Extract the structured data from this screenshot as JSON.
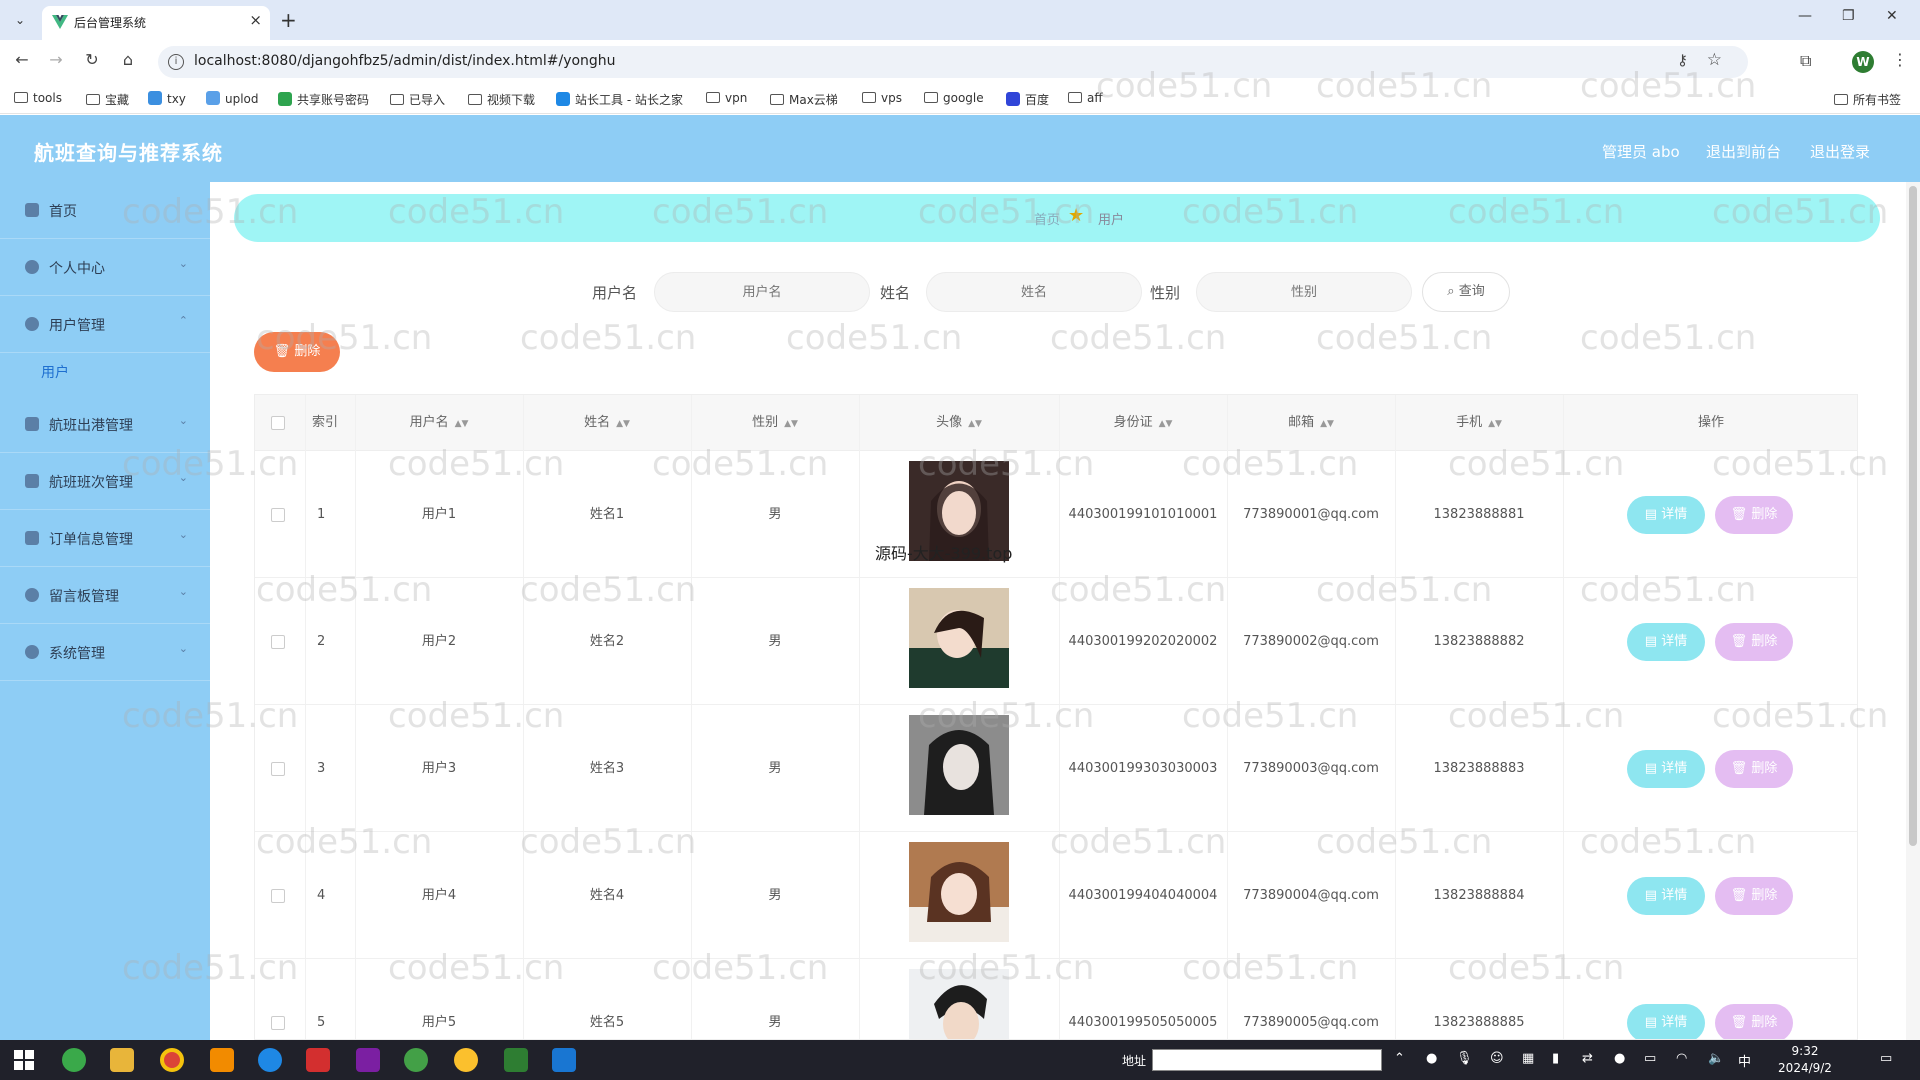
{
  "browser": {
    "tab_title": "后台管理系统",
    "url": "localhost:8080/djangohfbz5/admin/dist/index.html#/yonghu",
    "profile_initial": "W",
    "bookmarks": [
      "tools",
      "宝藏",
      "txy",
      "uplod",
      "共享账号密码",
      "已导入",
      "视频下载",
      "站长工具 - 站长之家",
      "vpn",
      "Max云梯",
      "vps",
      "google",
      "百度",
      "aff"
    ],
    "all_bookmarks": "所有书签"
  },
  "app": {
    "title": "航班查询与推荐系统",
    "header_links": [
      "管理员 abo",
      "退出到前台",
      "退出登录"
    ]
  },
  "sidebar": {
    "items": [
      {
        "label": "首页",
        "chevron": false
      },
      {
        "label": "个人中心",
        "chevron": true
      },
      {
        "label": "用户管理",
        "chevron": true
      },
      {
        "label": "航班出港管理",
        "chevron": true
      },
      {
        "label": "航班班次管理",
        "chevron": true
      },
      {
        "label": "订单信息管理",
        "chevron": true
      },
      {
        "label": "留言板管理",
        "chevron": true
      },
      {
        "label": "系统管理",
        "chevron": true
      }
    ],
    "sub_item": "用户"
  },
  "breadcrumb": {
    "home": "首页",
    "current": "用户"
  },
  "search": {
    "username_label": "用户名",
    "username_placeholder": "用户名",
    "name_label": "姓名",
    "name_placeholder": "姓名",
    "gender_label": "性别",
    "gender_placeholder": "性别",
    "button": "查询"
  },
  "delete_button": "删除",
  "table": {
    "headers": [
      "索引",
      "用户名",
      "姓名",
      "性别",
      "头像",
      "身份证",
      "邮箱",
      "手机",
      "操作"
    ],
    "detail_label": "详情",
    "delete_label": "删除",
    "rows": [
      {
        "index": "1",
        "username": "用户1",
        "name": "姓名1",
        "gender": "男",
        "id_card": "440300199101010001",
        "email": "773890001@qq.com",
        "phone": "13823888881"
      },
      {
        "index": "2",
        "username": "用户2",
        "name": "姓名2",
        "gender": "男",
        "id_card": "440300199202020002",
        "email": "773890002@qq.com",
        "phone": "13823888882"
      },
      {
        "index": "3",
        "username": "用户3",
        "name": "姓名3",
        "gender": "男",
        "id_card": "440300199303030003",
        "email": "773890003@qq.com",
        "phone": "13823888883"
      },
      {
        "index": "4",
        "username": "用户4",
        "name": "姓名4",
        "gender": "男",
        "id_card": "440300199404040004",
        "email": "773890004@qq.com",
        "phone": "13823888884"
      },
      {
        "index": "5",
        "username": "用户5",
        "name": "姓名5",
        "gender": "男",
        "id_card": "440300199505050005",
        "email": "773890005@qq.com",
        "phone": "13823888885"
      }
    ]
  },
  "overlay_text": "源码-大大-399.top",
  "watermark": "code51.cn",
  "taskbar": {
    "address_label": "地址",
    "tray_ime": "中",
    "time": "9:32",
    "date": "2024/9/2"
  },
  "colors": {
    "sidebar_bg": "#8ecdf5",
    "breadcrumb_bg": "#9ff5f5",
    "delete_orange": "#f57f4f",
    "detail_cyan": "#8ee6f0",
    "row_delete_purple": "#e4bdf2"
  }
}
